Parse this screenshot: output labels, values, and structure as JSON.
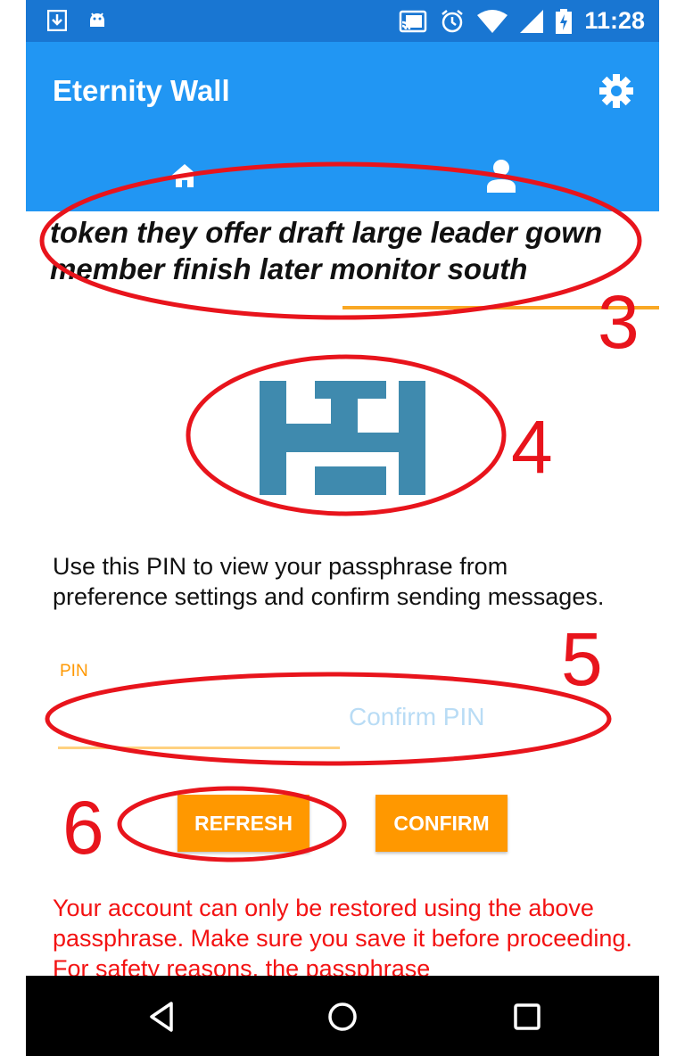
{
  "status_bar": {
    "time": "11:28",
    "icons": [
      "download-icon",
      "android-icon",
      "cast-icon",
      "alarm-icon",
      "wifi-icon",
      "signal-icon",
      "battery-charging-icon"
    ]
  },
  "app_bar": {
    "title": "Eternity Wall",
    "settings_icon": "gear-icon",
    "color": "#2196f3"
  },
  "tabs": [
    {
      "icon": "home-icon",
      "active": false
    },
    {
      "icon": "person-icon",
      "active": true
    }
  ],
  "passphrase": {
    "line1": "token they offer draft large leader gown",
    "line2": "member finish later monitor south"
  },
  "info_text": "Use this PIN to view your passphrase from preference settings and confirm sending messages.",
  "pin_form": {
    "pin_label": "PIN",
    "pin_value": "",
    "confirm_placeholder": "Confirm PIN"
  },
  "buttons": {
    "refresh": "REFRESH",
    "confirm": "CONFIRM"
  },
  "warning_text": "Your account can only be restored using the above passphrase. Make sure you save it before proceeding. For safety reasons, the passphrase",
  "annotations": {
    "a3": "3",
    "a4": "4",
    "a5": "5",
    "a6": "6"
  },
  "colors": {
    "accent": "#ff9800",
    "warning": "#f31212",
    "annotation": "#e8141c"
  }
}
